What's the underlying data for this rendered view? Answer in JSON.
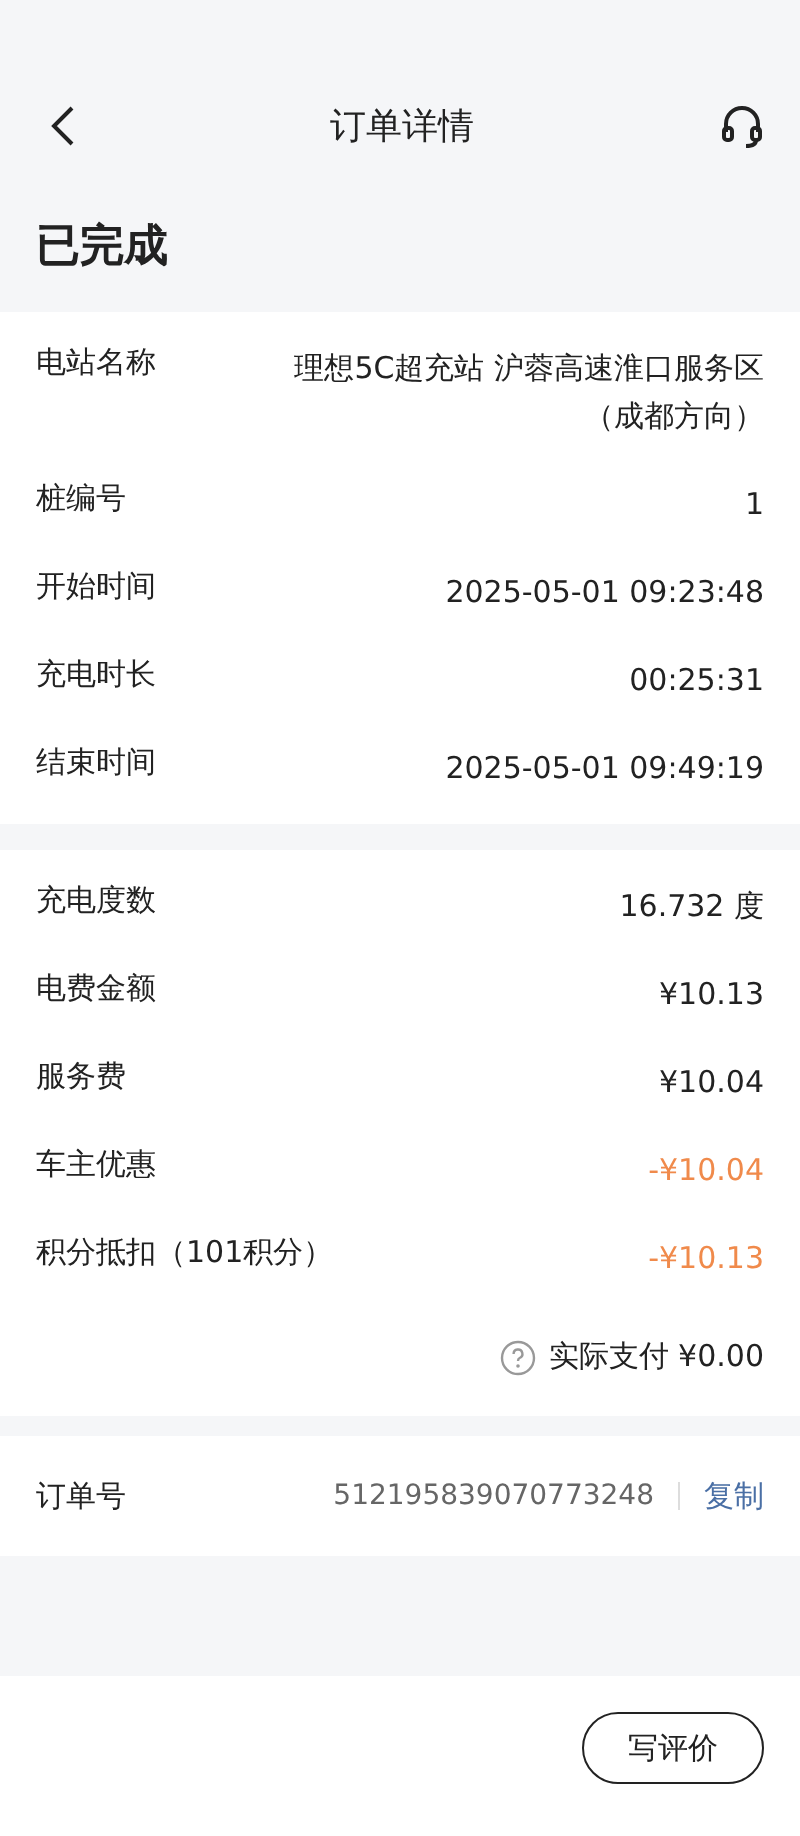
{
  "header": {
    "title": "订单详情"
  },
  "status": "已完成",
  "charging_info": [
    {
      "label": "电站名称",
      "value": "理想5C超充站 沪蓉高速淮口服务区（成都方向）"
    },
    {
      "label": "桩编号",
      "value": "1"
    },
    {
      "label": "开始时间",
      "value": "2025-05-01 09:23:48"
    },
    {
      "label": "充电时长",
      "value": "00:25:31"
    },
    {
      "label": "结束时间",
      "value": "2025-05-01 09:49:19"
    }
  ],
  "fees": [
    {
      "label": "充电度数",
      "value": "16.732 度",
      "kind": "normal"
    },
    {
      "label": "电费金额",
      "value": "¥10.13",
      "kind": "normal"
    },
    {
      "label": "服务费",
      "value": "¥10.04",
      "kind": "normal"
    },
    {
      "label": "车主优惠",
      "value": "-¥10.04",
      "kind": "discount"
    },
    {
      "label": "积分抵扣（101积分）",
      "value": "-¥10.13",
      "kind": "discount"
    }
  ],
  "total": "实际支付 ¥0.00",
  "order": {
    "label": "订单号",
    "number": "512195839070773248",
    "copy": "复制"
  },
  "review_button": "写评价"
}
